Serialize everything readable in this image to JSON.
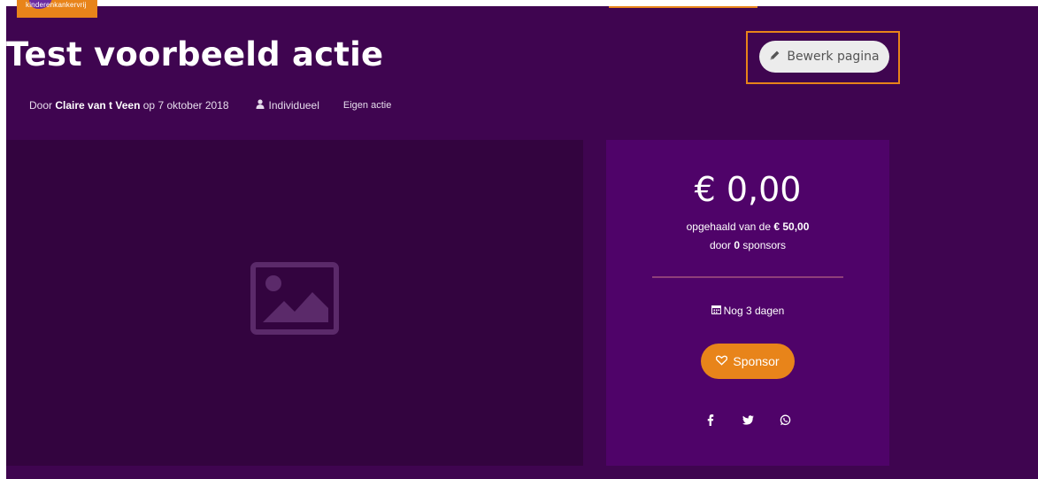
{
  "brand": {
    "logo_text": "kinderenkankervrij"
  },
  "campaign": {
    "title": "Test voorbeeld actie",
    "edit_label": "Bewerk pagina",
    "meta": {
      "by_label": "Door",
      "author": "Claire van t Veen",
      "date_prefix": "op",
      "date": "7 oktober 2018",
      "category": "Individueel",
      "tag": "Eigen actie"
    }
  },
  "donation": {
    "amount": "€ 0,00",
    "raised_prefix": "opgehaald van de",
    "goal": "€ 50,00",
    "sponsors_prefix": "door",
    "sponsor_count": "0",
    "sponsors_suffix": "sponsors",
    "days_left": "Nog 3 dagen",
    "sponsor_label": "Sponsor"
  },
  "icons": {
    "edit": "pencil-icon",
    "category": "user-icon",
    "days": "calendar-icon",
    "sponsor": "heart-icon",
    "image": "image-placeholder-icon",
    "share": [
      "facebook-icon",
      "twitter-icon",
      "whatsapp-icon"
    ]
  },
  "colors": {
    "background": "#3f0550",
    "image_panel": "#33043f",
    "side_panel": "#4f0369",
    "accent": "#e8841a",
    "edit_button": "#ececec"
  }
}
